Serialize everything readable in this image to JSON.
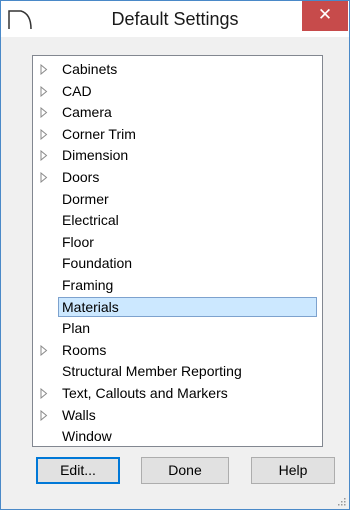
{
  "window": {
    "title": "Default Settings",
    "close_glyph": "✕"
  },
  "tree": {
    "items": [
      {
        "label": "Cabinets",
        "expandable": true
      },
      {
        "label": "CAD",
        "expandable": true
      },
      {
        "label": "Camera",
        "expandable": true
      },
      {
        "label": "Corner Trim",
        "expandable": true
      },
      {
        "label": "Dimension",
        "expandable": true
      },
      {
        "label": "Doors",
        "expandable": true
      },
      {
        "label": "Dormer",
        "expandable": false
      },
      {
        "label": "Electrical",
        "expandable": false
      },
      {
        "label": "Floor",
        "expandable": false
      },
      {
        "label": "Foundation",
        "expandable": false
      },
      {
        "label": "Framing",
        "expandable": false
      },
      {
        "label": "Materials",
        "expandable": false,
        "selected": true
      },
      {
        "label": "Plan",
        "expandable": false
      },
      {
        "label": "Rooms",
        "expandable": true
      },
      {
        "label": "Structural Member Reporting",
        "expandable": false
      },
      {
        "label": "Text, Callouts and Markers",
        "expandable": true
      },
      {
        "label": "Walls",
        "expandable": true
      },
      {
        "label": "Window",
        "expandable": false
      }
    ]
  },
  "buttons": {
    "edit": "Edit...",
    "done": "Done",
    "help": "Help"
  },
  "colors": {
    "close": "#c74b4b",
    "selection": "#cce8ff",
    "selection_border": "#7da2ce",
    "default_button_border": "#0078d7"
  }
}
